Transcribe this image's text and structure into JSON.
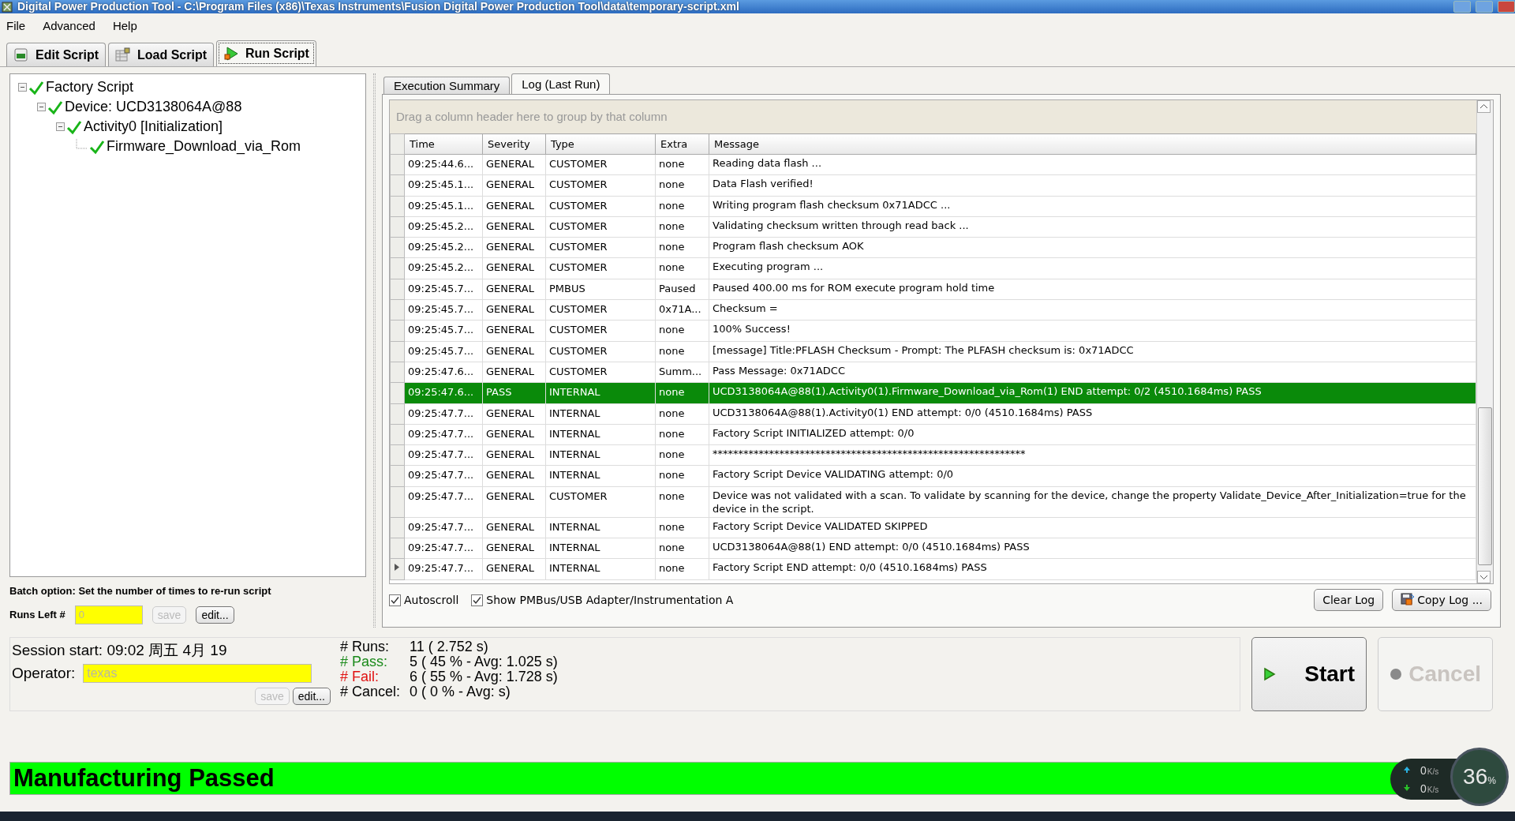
{
  "window": {
    "title": "Digital Power Production Tool - C:\\Program Files (x86)\\Texas Instruments\\Fusion Digital Power Production Tool\\data\\temporary-script.xml"
  },
  "menu": [
    "File",
    "Advanced",
    "Help"
  ],
  "toolbar_tabs": [
    {
      "label": "Edit Script",
      "kind": "edit",
      "selected": false
    },
    {
      "label": "Load Script",
      "kind": "load",
      "selected": false
    },
    {
      "label": "Run Script",
      "kind": "run",
      "selected": true
    }
  ],
  "tree": [
    {
      "label": "Factory Script",
      "checked": true,
      "expanded": true,
      "children": [
        {
          "label": "Device: UCD3138064A@88",
          "checked": true,
          "expanded": true,
          "children": [
            {
              "label": "Activity0 [Initialization]",
              "checked": true,
              "expanded": true,
              "children": [
                {
                  "label": "Firmware_Download_via_Rom",
                  "checked": true
                }
              ]
            }
          ]
        }
      ]
    }
  ],
  "batch": {
    "note": "Batch option: Set the number of times to re-run script",
    "runs_label": "Runs Left #",
    "runs_value": "0",
    "runs_disabled": true,
    "save": {
      "label": "save",
      "disabled": true
    },
    "edit": {
      "label": "edit...",
      "disabled": false
    }
  },
  "log_tabs": [
    {
      "label": "Execution Summary",
      "selected": false
    },
    {
      "label": "Log (Last Run)",
      "selected": true
    }
  ],
  "group_hint": "Drag a column header here to group by that column",
  "table": {
    "columns": [
      "Time",
      "Severity",
      "Type",
      "Extra",
      "Message"
    ],
    "rows": [
      {
        "cells": [
          "09:25:44.6...",
          "GENERAL",
          "CUSTOMER",
          "none",
          "Reading data flash ..."
        ],
        "selected": false,
        "current": false
      },
      {
        "cells": [
          "09:25:45.1...",
          "GENERAL",
          "CUSTOMER",
          "none",
          "Data Flash verified!"
        ],
        "selected": false,
        "current": false
      },
      {
        "cells": [
          "09:25:45.1...",
          "GENERAL",
          "CUSTOMER",
          "none",
          "Writing program flash checksum 0x71ADCC ..."
        ],
        "selected": false,
        "current": false
      },
      {
        "cells": [
          "09:25:45.2...",
          "GENERAL",
          "CUSTOMER",
          "none",
          "Validating checksum written through read back ..."
        ],
        "selected": false,
        "current": false
      },
      {
        "cells": [
          "09:25:45.2...",
          "GENERAL",
          "CUSTOMER",
          "none",
          "Program flash checksum AOK"
        ],
        "selected": false,
        "current": false
      },
      {
        "cells": [
          "09:25:45.2...",
          "GENERAL",
          "CUSTOMER",
          "none",
          "Executing program ..."
        ],
        "selected": false,
        "current": false
      },
      {
        "cells": [
          "09:25:45.7...",
          "GENERAL",
          "PMBUS",
          "Paused",
          "Paused 400.00 ms for ROM execute program hold time"
        ],
        "selected": false,
        "current": false
      },
      {
        "cells": [
          "09:25:45.7...",
          "GENERAL",
          "CUSTOMER",
          "0x71A...",
          "Checksum ="
        ],
        "selected": false,
        "current": false
      },
      {
        "cells": [
          "09:25:45.7...",
          "GENERAL",
          "CUSTOMER",
          "none",
          "100% Success!"
        ],
        "selected": false,
        "current": false
      },
      {
        "cells": [
          "09:25:45.7...",
          "GENERAL",
          "CUSTOMER",
          "none",
          "[message] Title:PFLASH Checksum - Prompt: The PLFASH checksum is: 0x71ADCC"
        ],
        "selected": false,
        "current": false
      },
      {
        "cells": [
          "09:25:47.6...",
          "GENERAL",
          "CUSTOMER",
          "Summ...",
          "Pass Message: 0x71ADCC"
        ],
        "selected": false,
        "current": false
      },
      {
        "cells": [
          "09:25:47.6...",
          "PASS",
          "INTERNAL",
          "none",
          "UCD3138064A@88(1).Activity0(1).Firmware_Download_via_Rom(1) END attempt: 0/2 (4510.1684ms) PASS"
        ],
        "selected": true,
        "current": false
      },
      {
        "cells": [
          "09:25:47.7...",
          "GENERAL",
          "INTERNAL",
          "none",
          "UCD3138064A@88(1).Activity0(1) END attempt: 0/0 (4510.1684ms) PASS"
        ],
        "selected": false,
        "current": false
      },
      {
        "cells": [
          "09:25:47.7...",
          "GENERAL",
          "INTERNAL",
          "none",
          "Factory Script INITIALIZED attempt: 0/0"
        ],
        "selected": false,
        "current": false
      },
      {
        "cells": [
          "09:25:47.7...",
          "GENERAL",
          "INTERNAL",
          "none",
          "*************************************************************"
        ],
        "selected": false,
        "current": false
      },
      {
        "cells": [
          "09:25:47.7...",
          "GENERAL",
          "INTERNAL",
          "none",
          "Factory Script Device VALIDATING attempt: 0/0"
        ],
        "selected": false,
        "current": false
      },
      {
        "cells": [
          "09:25:47.7...",
          "GENERAL",
          "CUSTOMER",
          "none",
          "Device was not validated with a scan.  To validate by scanning for the device, change the property Validate_Device_After_Initialization=true for the device in the script."
        ],
        "selected": false,
        "current": false
      },
      {
        "cells": [
          "09:25:47.7...",
          "GENERAL",
          "INTERNAL",
          "none",
          "Factory Script Device VALIDATED SKIPPED"
        ],
        "selected": false,
        "current": false
      },
      {
        "cells": [
          "09:25:47.7...",
          "GENERAL",
          "INTERNAL",
          "none",
          "UCD3138064A@88(1) END attempt: 0/0 (4510.1684ms) PASS"
        ],
        "selected": false,
        "current": false
      },
      {
        "cells": [
          "09:25:47.7...",
          "GENERAL",
          "INTERNAL",
          "none",
          "Factory Script END attempt: 0/0 (4510.1684ms) PASS"
        ],
        "selected": false,
        "current": true
      }
    ]
  },
  "options": [
    {
      "label": "Autoscroll",
      "checked": true
    },
    {
      "label": "Show PMBus/USB Adapter/Instrumentation A",
      "checked": true
    }
  ],
  "log_buttons": [
    {
      "label": "Clear Log",
      "kind": "plain"
    },
    {
      "label": "Copy Log ...",
      "kind": "copy"
    }
  ],
  "session": {
    "start": "Session start: 09:02 周五 4月 19",
    "operator_label": "Operator:",
    "operator_value": "texas",
    "operator_disabled": true,
    "save": {
      "label": "save",
      "disabled": true
    },
    "edit": {
      "label": "edit...",
      "disabled": false
    }
  },
  "stats": [
    {
      "label": "# Runs:",
      "value": "11 ( 2.752 s)",
      "kind": "plain"
    },
    {
      "label": "# Pass:",
      "value": "5 ( 45 % - Avg: 1.025 s)",
      "kind": "pass"
    },
    {
      "label": "# Fail:",
      "value": "6 ( 55 % - Avg: 1.728 s)",
      "kind": "fail"
    },
    {
      "label": "# Cancel:",
      "value": "0 ( 0 % - Avg:  s)",
      "kind": "plain"
    }
  ],
  "start_button": {
    "label": "Start",
    "disabled": false
  },
  "cancel_button": {
    "label": "Cancel",
    "disabled": true
  },
  "status": {
    "text": "Manufacturing Passed",
    "kind": "pass"
  },
  "net_widget": {
    "upload": "0",
    "upload_unit": "K/s",
    "download": "0",
    "download_unit": "K/s",
    "percent": "36",
    "percent_sign": "%"
  }
}
